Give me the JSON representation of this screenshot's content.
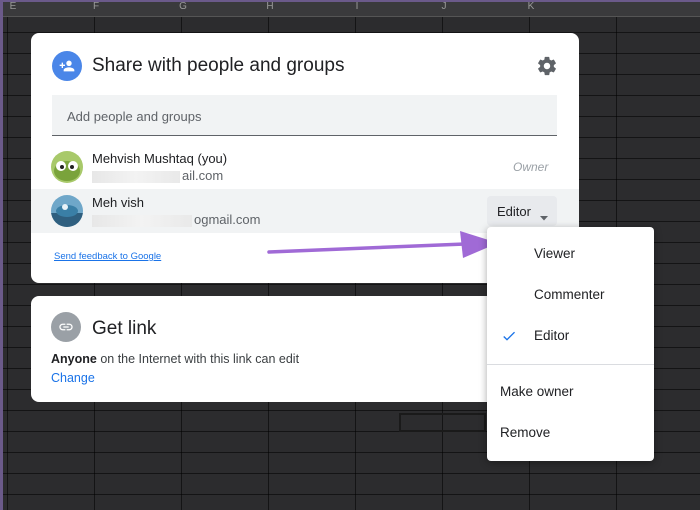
{
  "spreadsheet": {
    "columns": [
      "E",
      "F",
      "G",
      "H",
      "I",
      "J",
      "K"
    ]
  },
  "share_dialog": {
    "title": "Share with people and groups",
    "add_placeholder": "Add people and groups",
    "people": [
      {
        "name": "Mehvish Mushtaq (you)",
        "email_visible": "ail.com",
        "role": "Owner"
      },
      {
        "name": "Meh vish",
        "email_visible": "ogmail.com",
        "role": "Editor"
      }
    ],
    "feedback_link": "Send feedback to Google"
  },
  "get_link": {
    "title": "Get link",
    "description_bold": "Anyone",
    "description_rest": " on the Internet with this link can edit",
    "change_label": "Change"
  },
  "role_menu": {
    "items": [
      "Viewer",
      "Commenter",
      "Editor"
    ],
    "selected": "Editor",
    "actions": [
      "Make owner",
      "Remove"
    ]
  },
  "colors": {
    "accent_blue": "#1a73e8",
    "share_icon_bg": "#4a86e8",
    "arrow_purple": "#a06ad6"
  }
}
